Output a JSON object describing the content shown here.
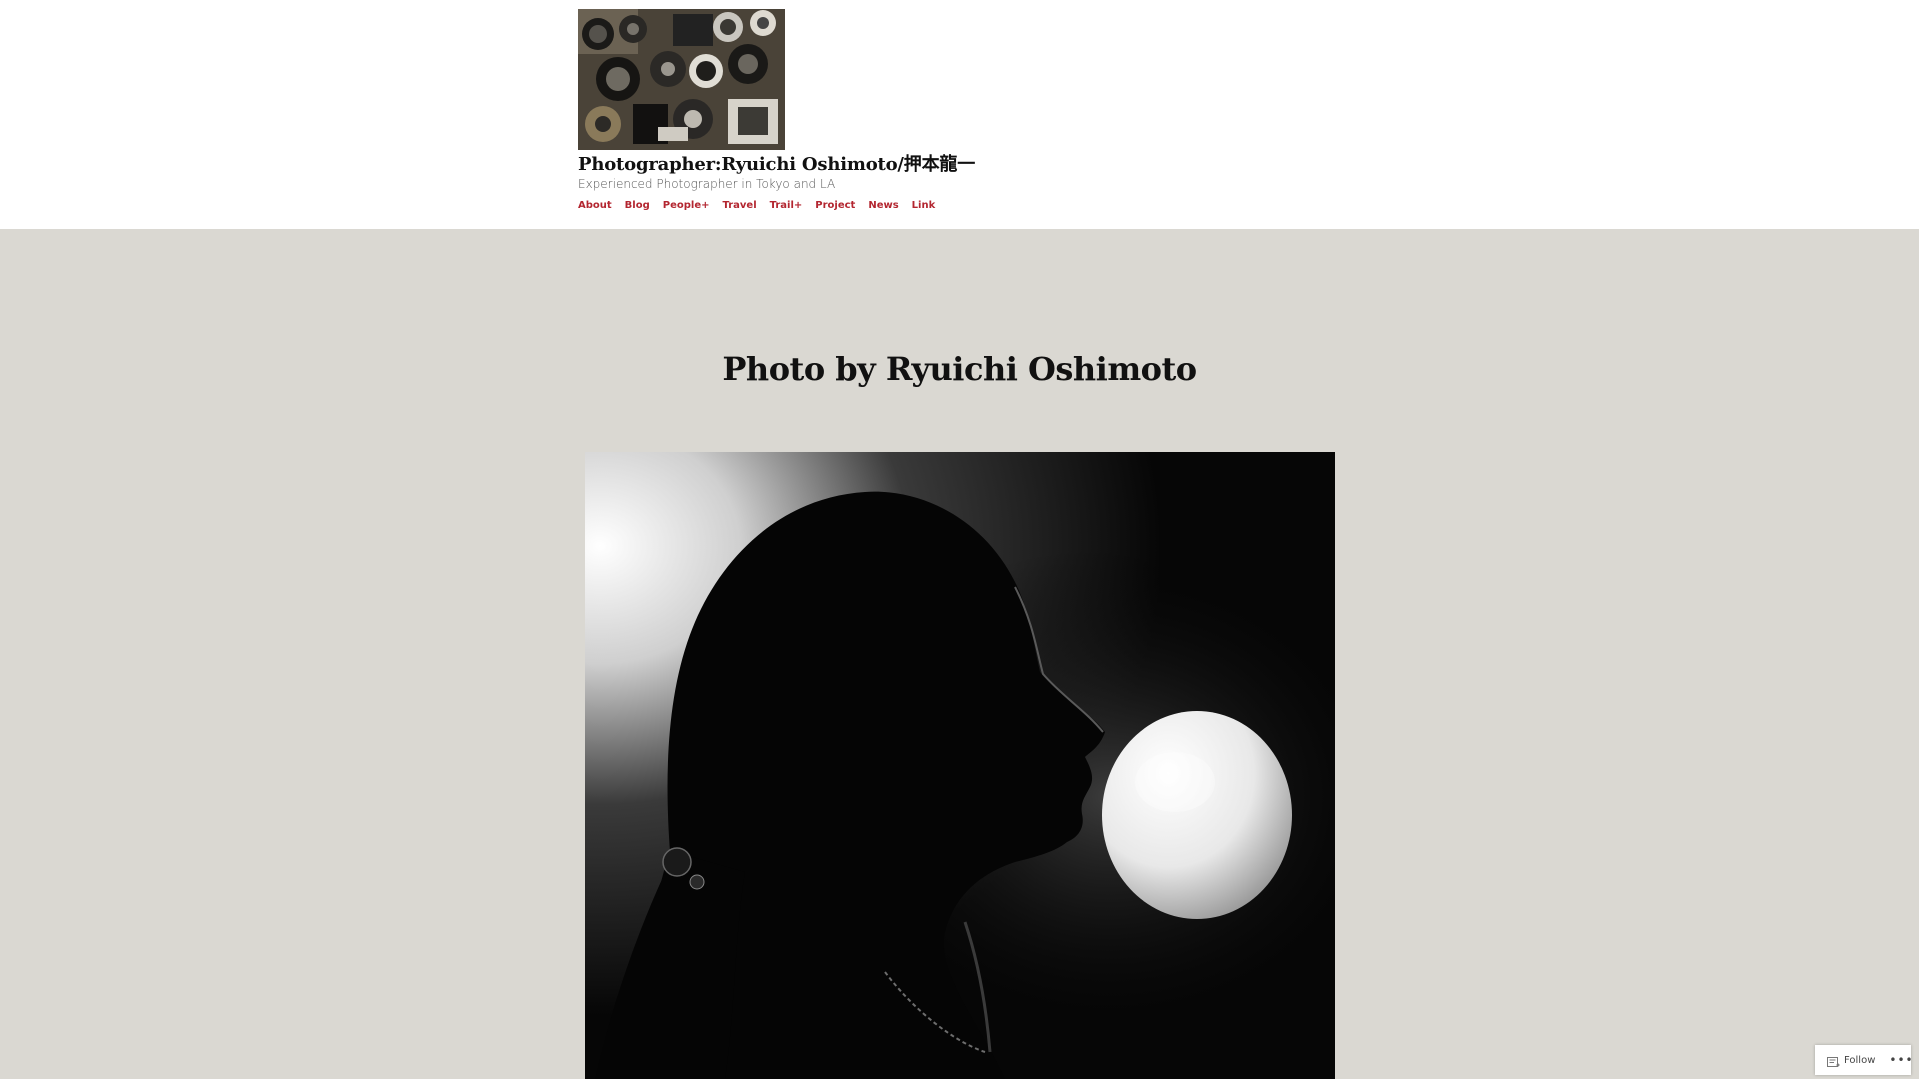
{
  "site": {
    "title": "Photographer:Ryuichi Oshimoto/押本龍一",
    "tagline": "Experienced Photographer in Tokyo and LA",
    "logo_icon": "camera-lenses-collage-image"
  },
  "nav": {
    "items": [
      {
        "label": "About"
      },
      {
        "label": "Blog"
      },
      {
        "label": "People+"
      },
      {
        "label": "Travel"
      },
      {
        "label": "Trail+"
      },
      {
        "label": "Project"
      },
      {
        "label": "News"
      },
      {
        "label": "Link"
      }
    ]
  },
  "main": {
    "page_title": "Photo by Ryuichi Oshimoto",
    "photo_icon": "bubble-gum-portrait-image"
  },
  "follow": {
    "label": "Follow",
    "more_label": "•••",
    "icon": "reader-follow-icon"
  },
  "colors": {
    "header_bg": "#ffffff",
    "page_bg": "#dad8d2",
    "nav_link": "#b32630",
    "title_text": "#111111"
  }
}
